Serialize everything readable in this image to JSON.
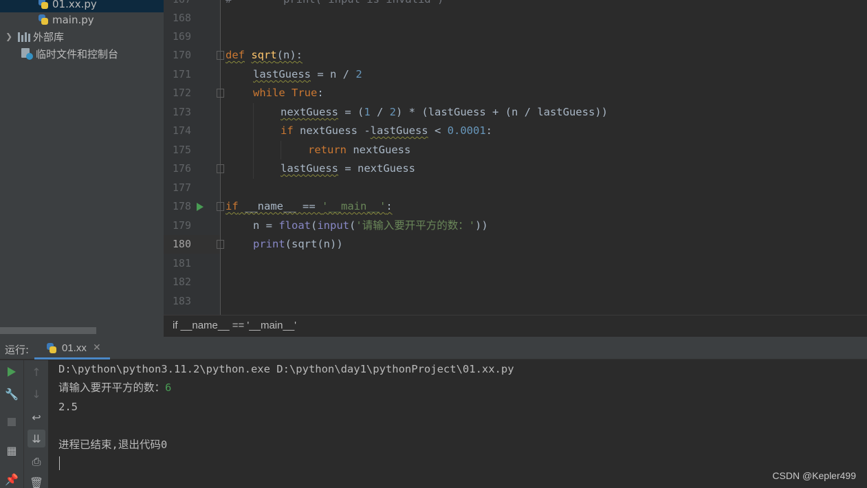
{
  "project_tree": {
    "items": [
      {
        "label": "01.xx.py",
        "icon": "python-file-icon",
        "selected": true
      },
      {
        "label": "main.py",
        "icon": "python-file-icon"
      },
      {
        "label": "外部库",
        "icon": "library-icon",
        "expandable": true
      },
      {
        "label": "临时文件和控制台",
        "icon": "scratches-icon"
      }
    ]
  },
  "editor": {
    "line_numbers": [
      "167",
      "168",
      "169",
      "170",
      "171",
      "172",
      "173",
      "174",
      "175",
      "176",
      "177",
      "178",
      "179",
      "180",
      "181",
      "182",
      "183"
    ],
    "current_line": "180",
    "partial_top_line": "#        print('input is invalid')",
    "code": {
      "l170": {
        "kw": "def",
        "name": "sqrt",
        "args": "(n):"
      },
      "l171": {
        "var": "lastGuess",
        "rest": " = n / ",
        "num": "2"
      },
      "l172": {
        "kw": "while",
        "const": "True",
        "colon": ":"
      },
      "l173": {
        "var": "nextGuess",
        "p1": " = (",
        "n1": "1",
        "p2": " / ",
        "n2": "2",
        "p3": ") * (lastGuess + (n / lastGuess))"
      },
      "l174": {
        "kw": "if",
        "p1": " nextGuess -",
        "var": "lastGuess",
        "p2": " < ",
        "num": "0.0001",
        "p3": ":"
      },
      "l175": {
        "kw": "return",
        "rest": " nextGuess"
      },
      "l176": {
        "var": "lastGuess",
        "rest": " = nextGuess"
      },
      "l178": {
        "kw": "if",
        "p1": " __name__ == ",
        "str": "'__main__'",
        "p2": ":"
      },
      "l179": {
        "p1": "n = ",
        "b1": "float",
        "p2": "(",
        "b2": "input",
        "p3": "(",
        "str": "'请输入要开平方的数：'",
        "p4": "))"
      },
      "l180": {
        "b1": "print",
        "rest": "(sqrt(n))"
      }
    }
  },
  "breadcrumb": {
    "text": "if __name__ == '__main__'"
  },
  "run_panel": {
    "label": "运行:",
    "tab": {
      "name": "01.xx",
      "icon": "python-file-icon",
      "close": "✕"
    },
    "toolbar_left": [
      {
        "name": "rerun-icon",
        "active": false
      },
      {
        "name": "wrench-icon",
        "active": false
      },
      {
        "name": "stop-icon",
        "active": false
      },
      {
        "name": "layout-icon",
        "active": false
      },
      {
        "name": "pin-icon",
        "active": false
      }
    ],
    "toolbar_right": [
      {
        "name": "up-arrow-icon",
        "glyph": "↑"
      },
      {
        "name": "down-arrow-icon",
        "glyph": "↓"
      },
      {
        "name": "soft-wrap-icon",
        "glyph": "↩"
      },
      {
        "name": "scroll-to-end-icon",
        "glyph": "⇊",
        "active": true
      },
      {
        "name": "print-icon",
        "glyph": "⎙"
      },
      {
        "name": "trash-icon",
        "glyph": "🗑"
      }
    ],
    "console": {
      "command": "D:\\python\\python3.11.2\\python.exe D:\\python\\day1\\pythonProject\\01.xx.py",
      "prompt": "请输入要开平方的数：",
      "user_input": "6",
      "result": "2.5",
      "exit_message": "进程已结束,退出代码0"
    }
  },
  "watermark": "CSDN @Kepler499"
}
